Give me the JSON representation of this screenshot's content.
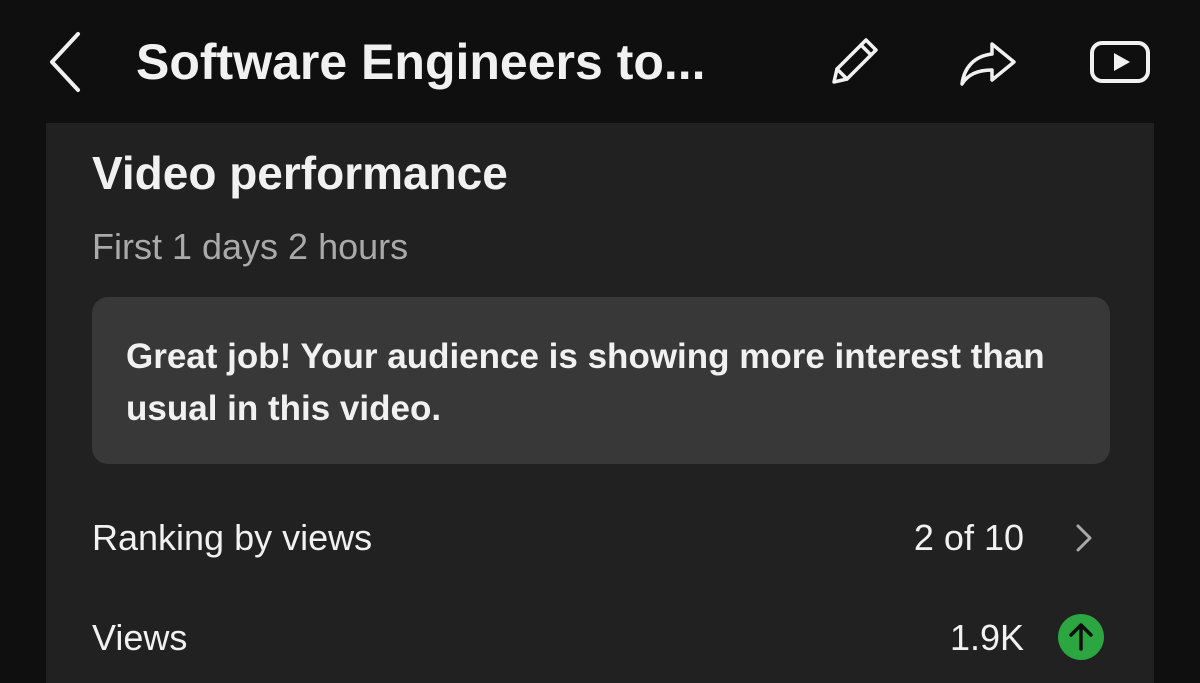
{
  "header": {
    "title": "Software Engineers to...",
    "icons": {
      "back": "chevron-left-icon",
      "edit": "pencil-icon",
      "share": "share-icon",
      "youtube": "youtube-icon"
    }
  },
  "card": {
    "title": "Video performance",
    "subtitle": "First 1 days 2 hours",
    "banner_text": "Great job! Your audience is showing more interest than usual in this video.",
    "rows": [
      {
        "label": "Ranking by views",
        "value": "2 of 10",
        "icon": "chevron-right-icon"
      },
      {
        "label": "Views",
        "value": "1.9K",
        "icon": "arrow-up-icon",
        "trend": "up"
      }
    ]
  },
  "colors": {
    "background": "#0f0f0f",
    "card": "#212121",
    "banner": "#383838",
    "text_primary": "#f1f1f1",
    "text_secondary": "#aaaaaa",
    "trend_up": "#2ba640"
  }
}
